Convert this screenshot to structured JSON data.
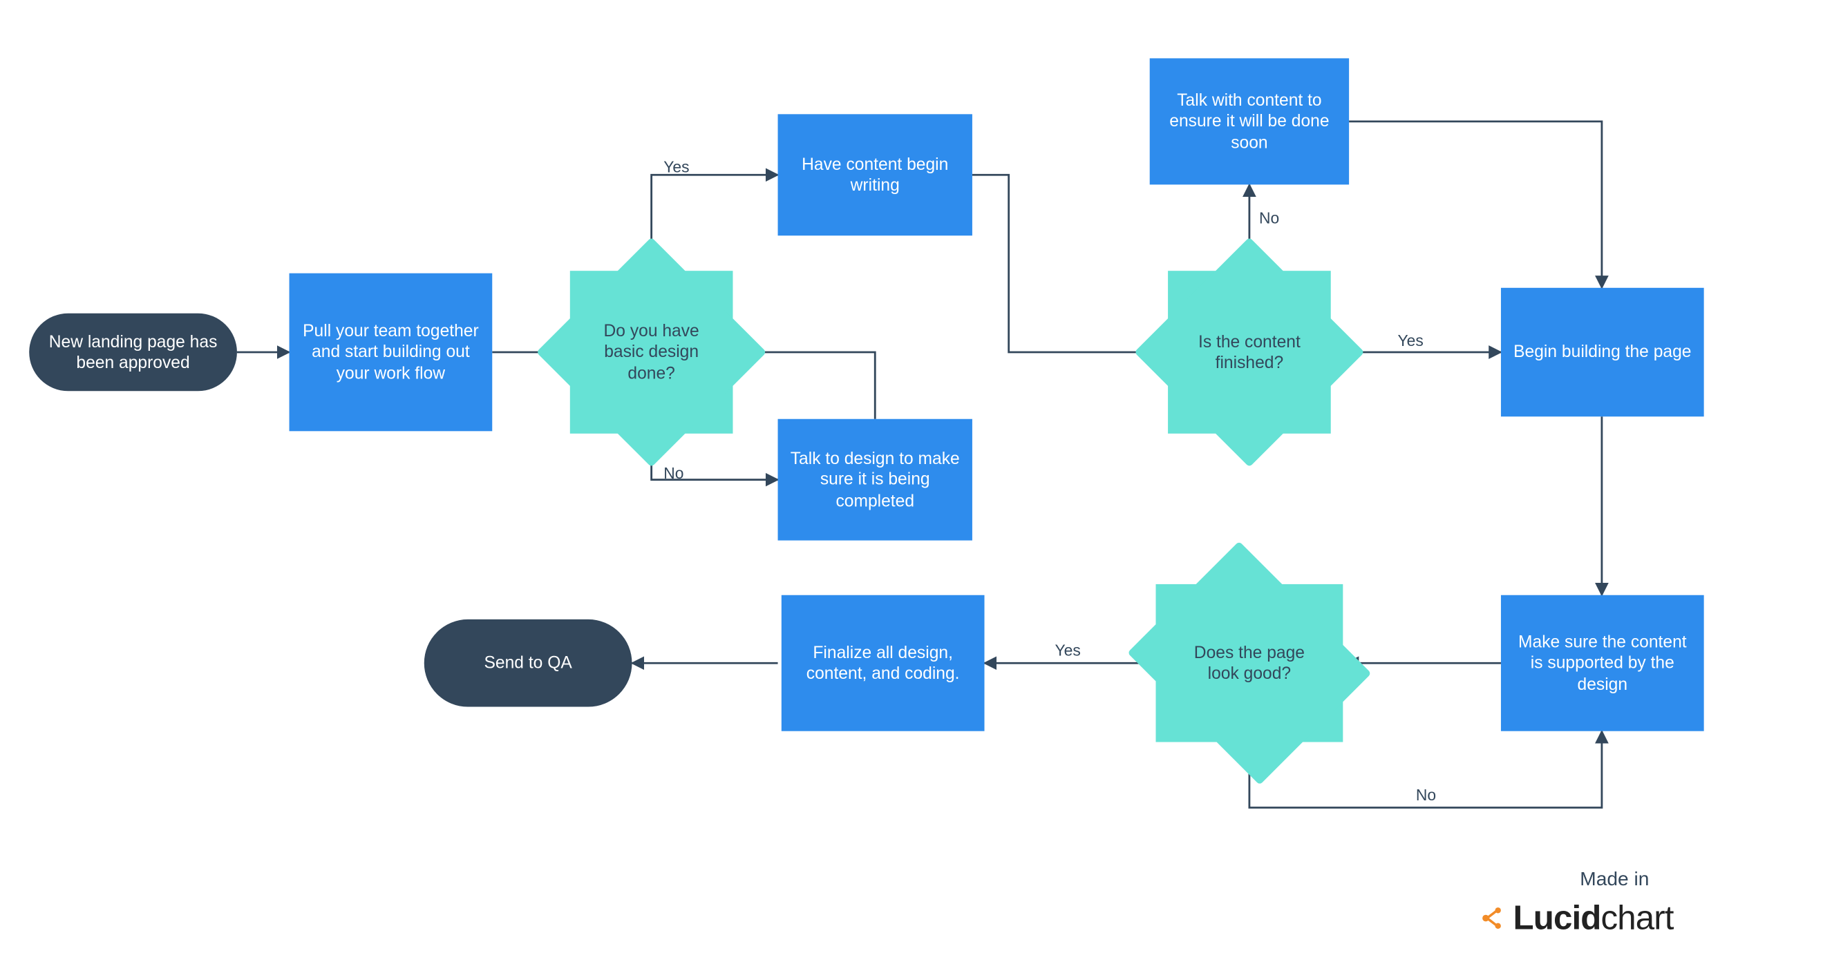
{
  "chart_data": {
    "type": "flowchart",
    "nodes": [
      {
        "id": "start",
        "shape": "terminal",
        "text": "New landing page has been approved"
      },
      {
        "id": "teamPull",
        "shape": "process",
        "text": "Pull your team together and start building out your work flow"
      },
      {
        "id": "designDone",
        "shape": "decision",
        "text": "Do you have basic design done?"
      },
      {
        "id": "haveContent",
        "shape": "process",
        "text": "Have content begin writing"
      },
      {
        "id": "talkDesign",
        "shape": "process",
        "text": "Talk to design to make sure it is being completed"
      },
      {
        "id": "contentFinished",
        "shape": "decision",
        "text": "Is the content finished?"
      },
      {
        "id": "talkContent",
        "shape": "process",
        "text": "Talk with content to ensure it will be done soon"
      },
      {
        "id": "beginBuild",
        "shape": "process",
        "text": "Begin building the page"
      },
      {
        "id": "makeSure",
        "shape": "process",
        "text": "Make sure the content is supported by the design"
      },
      {
        "id": "lookGood",
        "shape": "decision",
        "text": "Does the page look good?"
      },
      {
        "id": "finalize",
        "shape": "process",
        "text": "Finalize all design, content, and coding."
      },
      {
        "id": "sendQA",
        "shape": "terminal",
        "text": "Send to QA"
      }
    ],
    "edges": [
      {
        "from": "start",
        "to": "teamPull",
        "label": ""
      },
      {
        "from": "teamPull",
        "to": "designDone",
        "label": ""
      },
      {
        "from": "designDone",
        "to": "haveContent",
        "label": "Yes"
      },
      {
        "from": "designDone",
        "to": "talkDesign",
        "label": "No"
      },
      {
        "from": "talkDesign",
        "to": "designDone",
        "label": ""
      },
      {
        "from": "haveContent",
        "to": "contentFinished",
        "label": ""
      },
      {
        "from": "contentFinished",
        "to": "talkContent",
        "label": "No"
      },
      {
        "from": "talkContent",
        "to": "beginBuild",
        "label": ""
      },
      {
        "from": "contentFinished",
        "to": "beginBuild",
        "label": "Yes"
      },
      {
        "from": "beginBuild",
        "to": "makeSure",
        "label": ""
      },
      {
        "from": "makeSure",
        "to": "lookGood",
        "label": ""
      },
      {
        "from": "lookGood",
        "to": "makeSure",
        "label": "No"
      },
      {
        "from": "lookGood",
        "to": "finalize",
        "label": "Yes"
      },
      {
        "from": "finalize",
        "to": "sendQA",
        "label": ""
      }
    ]
  },
  "labels": {
    "yes": "Yes",
    "no": "No"
  },
  "colors": {
    "terminal": "#33475b",
    "process": "#2e8ced",
    "decision": "#66e2d5",
    "edge": "#33475b"
  },
  "branding": {
    "made_in": "Made in",
    "product": "Lucidchart"
  }
}
